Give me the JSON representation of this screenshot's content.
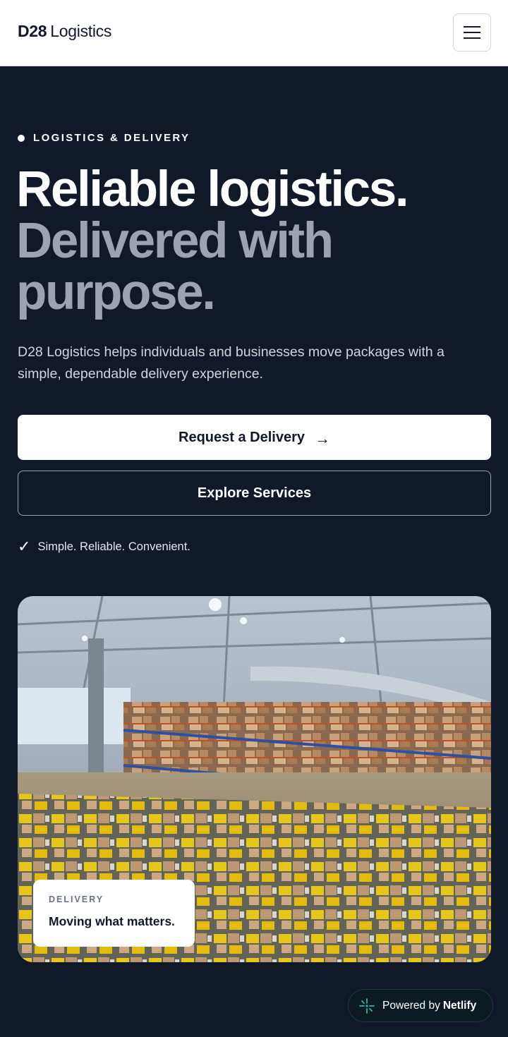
{
  "header": {
    "logo_strong": "D28",
    "logo_light": "Logistics",
    "menu_icon": "hamburger-menu-icon"
  },
  "hero": {
    "eyebrow": "LOGISTICS & DELIVERY",
    "headline_line1": "Reliable logistics.",
    "headline_line2": "Delivered with purpose.",
    "lead": "D28 Logistics helps individuals and businesses move packages with a simple, dependable delivery experience.",
    "primary_cta": "Request a Delivery",
    "primary_cta_icon": "→",
    "secondary_cta": "Explore Services",
    "tagline_icon": "✓",
    "tagline": "Simple. Reliable. Convenient."
  },
  "image_card": {
    "image": "warehouse-shelves-with-yellow-bins-and-boxes",
    "overlay_eyebrow": "DELIVERY",
    "overlay_title": "Moving what matters."
  },
  "badge": {
    "prefix": "Powered by",
    "brand": "Netlify",
    "icon": "netlify-icon"
  },
  "colors": {
    "background": "#111827",
    "header_background": "#ffffff",
    "headline_muted": "#9ca3af",
    "accent_yellow": "#f4d31c"
  }
}
